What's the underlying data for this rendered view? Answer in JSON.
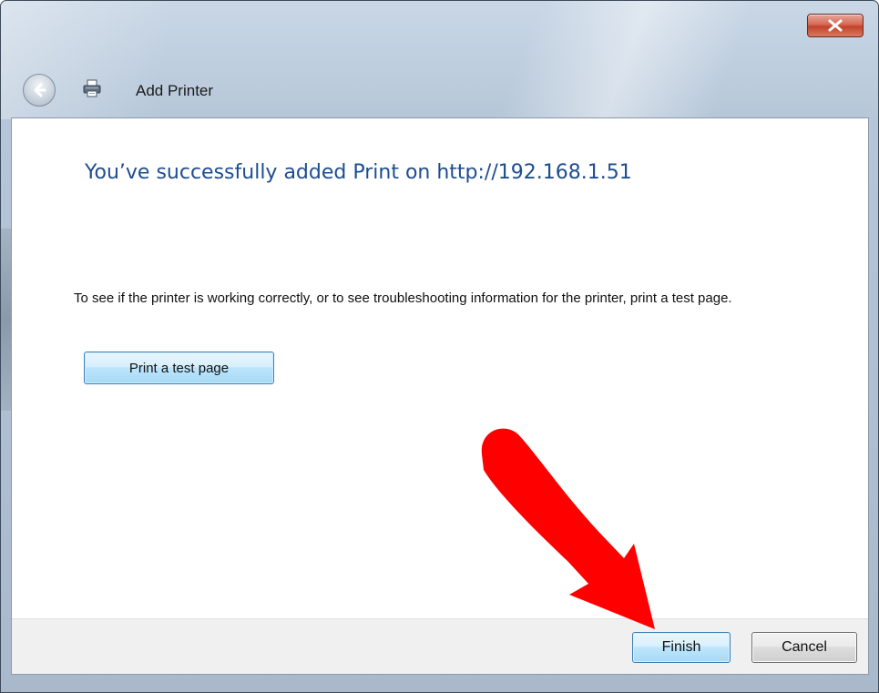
{
  "window": {
    "title": "Add Printer",
    "close_symbol": "x"
  },
  "main": {
    "heading": "You’ve successfully added Print on http://192.168.1.51",
    "description": "To see if the printer is working correctly, or to see troubleshooting information for the printer, print a test page.",
    "test_page_button": "Print a test page"
  },
  "footer": {
    "finish_label": "Finish",
    "cancel_label": "Cancel"
  },
  "icons": {
    "back": "back-arrow-icon",
    "printer": "printer-icon",
    "close": "close-icon",
    "annotation": "red-arrow-annotation"
  },
  "colors": {
    "heading": "#1e4d8f",
    "close_button": "#c2432c",
    "primary_button": "#a7d9f5",
    "annotation_arrow": "#ff0000"
  }
}
